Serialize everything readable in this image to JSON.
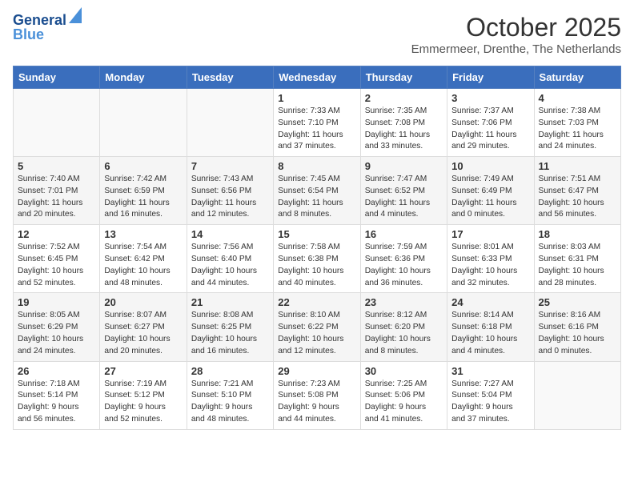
{
  "logo": {
    "line1": "General",
    "line2": "Blue"
  },
  "title": "October 2025",
  "subtitle": "Emmermeer, Drenthe, The Netherlands",
  "headers": [
    "Sunday",
    "Monday",
    "Tuesday",
    "Wednesday",
    "Thursday",
    "Friday",
    "Saturday"
  ],
  "weeks": [
    [
      {
        "day": "",
        "info": ""
      },
      {
        "day": "",
        "info": ""
      },
      {
        "day": "",
        "info": ""
      },
      {
        "day": "1",
        "info": "Sunrise: 7:33 AM\nSunset: 7:10 PM\nDaylight: 11 hours\nand 37 minutes."
      },
      {
        "day": "2",
        "info": "Sunrise: 7:35 AM\nSunset: 7:08 PM\nDaylight: 11 hours\nand 33 minutes."
      },
      {
        "day": "3",
        "info": "Sunrise: 7:37 AM\nSunset: 7:06 PM\nDaylight: 11 hours\nand 29 minutes."
      },
      {
        "day": "4",
        "info": "Sunrise: 7:38 AM\nSunset: 7:03 PM\nDaylight: 11 hours\nand 24 minutes."
      }
    ],
    [
      {
        "day": "5",
        "info": "Sunrise: 7:40 AM\nSunset: 7:01 PM\nDaylight: 11 hours\nand 20 minutes."
      },
      {
        "day": "6",
        "info": "Sunrise: 7:42 AM\nSunset: 6:59 PM\nDaylight: 11 hours\nand 16 minutes."
      },
      {
        "day": "7",
        "info": "Sunrise: 7:43 AM\nSunset: 6:56 PM\nDaylight: 11 hours\nand 12 minutes."
      },
      {
        "day": "8",
        "info": "Sunrise: 7:45 AM\nSunset: 6:54 PM\nDaylight: 11 hours\nand 8 minutes."
      },
      {
        "day": "9",
        "info": "Sunrise: 7:47 AM\nSunset: 6:52 PM\nDaylight: 11 hours\nand 4 minutes."
      },
      {
        "day": "10",
        "info": "Sunrise: 7:49 AM\nSunset: 6:49 PM\nDaylight: 11 hours\nand 0 minutes."
      },
      {
        "day": "11",
        "info": "Sunrise: 7:51 AM\nSunset: 6:47 PM\nDaylight: 10 hours\nand 56 minutes."
      }
    ],
    [
      {
        "day": "12",
        "info": "Sunrise: 7:52 AM\nSunset: 6:45 PM\nDaylight: 10 hours\nand 52 minutes."
      },
      {
        "day": "13",
        "info": "Sunrise: 7:54 AM\nSunset: 6:42 PM\nDaylight: 10 hours\nand 48 minutes."
      },
      {
        "day": "14",
        "info": "Sunrise: 7:56 AM\nSunset: 6:40 PM\nDaylight: 10 hours\nand 44 minutes."
      },
      {
        "day": "15",
        "info": "Sunrise: 7:58 AM\nSunset: 6:38 PM\nDaylight: 10 hours\nand 40 minutes."
      },
      {
        "day": "16",
        "info": "Sunrise: 7:59 AM\nSunset: 6:36 PM\nDaylight: 10 hours\nand 36 minutes."
      },
      {
        "day": "17",
        "info": "Sunrise: 8:01 AM\nSunset: 6:33 PM\nDaylight: 10 hours\nand 32 minutes."
      },
      {
        "day": "18",
        "info": "Sunrise: 8:03 AM\nSunset: 6:31 PM\nDaylight: 10 hours\nand 28 minutes."
      }
    ],
    [
      {
        "day": "19",
        "info": "Sunrise: 8:05 AM\nSunset: 6:29 PM\nDaylight: 10 hours\nand 24 minutes."
      },
      {
        "day": "20",
        "info": "Sunrise: 8:07 AM\nSunset: 6:27 PM\nDaylight: 10 hours\nand 20 minutes."
      },
      {
        "day": "21",
        "info": "Sunrise: 8:08 AM\nSunset: 6:25 PM\nDaylight: 10 hours\nand 16 minutes."
      },
      {
        "day": "22",
        "info": "Sunrise: 8:10 AM\nSunset: 6:22 PM\nDaylight: 10 hours\nand 12 minutes."
      },
      {
        "day": "23",
        "info": "Sunrise: 8:12 AM\nSunset: 6:20 PM\nDaylight: 10 hours\nand 8 minutes."
      },
      {
        "day": "24",
        "info": "Sunrise: 8:14 AM\nSunset: 6:18 PM\nDaylight: 10 hours\nand 4 minutes."
      },
      {
        "day": "25",
        "info": "Sunrise: 8:16 AM\nSunset: 6:16 PM\nDaylight: 10 hours\nand 0 minutes."
      }
    ],
    [
      {
        "day": "26",
        "info": "Sunrise: 7:18 AM\nSunset: 5:14 PM\nDaylight: 9 hours\nand 56 minutes."
      },
      {
        "day": "27",
        "info": "Sunrise: 7:19 AM\nSunset: 5:12 PM\nDaylight: 9 hours\nand 52 minutes."
      },
      {
        "day": "28",
        "info": "Sunrise: 7:21 AM\nSunset: 5:10 PM\nDaylight: 9 hours\nand 48 minutes."
      },
      {
        "day": "29",
        "info": "Sunrise: 7:23 AM\nSunset: 5:08 PM\nDaylight: 9 hours\nand 44 minutes."
      },
      {
        "day": "30",
        "info": "Sunrise: 7:25 AM\nSunset: 5:06 PM\nDaylight: 9 hours\nand 41 minutes."
      },
      {
        "day": "31",
        "info": "Sunrise: 7:27 AM\nSunset: 5:04 PM\nDaylight: 9 hours\nand 37 minutes."
      },
      {
        "day": "",
        "info": ""
      }
    ]
  ]
}
